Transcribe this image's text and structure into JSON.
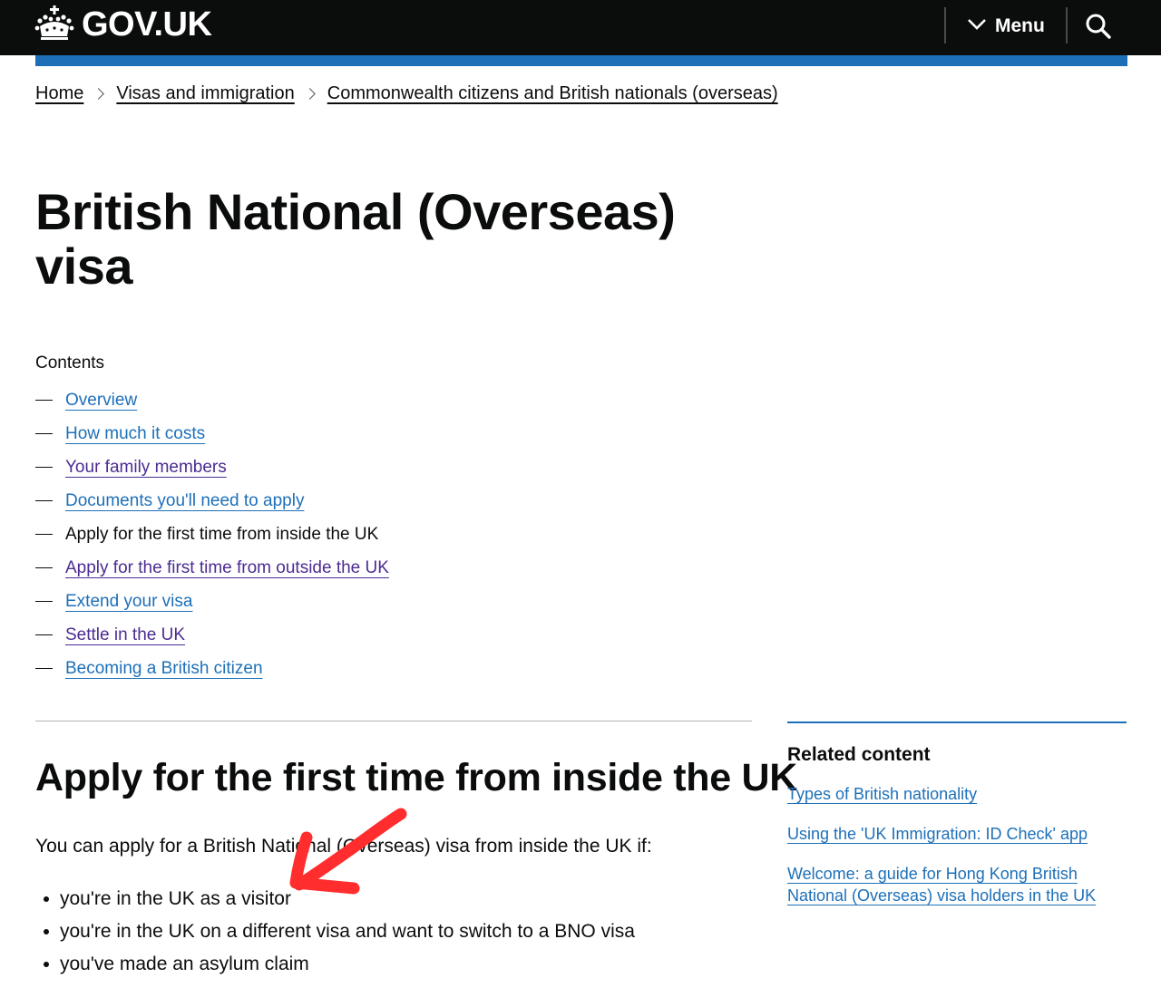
{
  "header": {
    "logo_text": "GOV.UK",
    "logo_icon": "crown-icon",
    "menu_label": "Menu",
    "menu_icon": "chevron-down-icon",
    "search_icon": "search-icon",
    "colors": {
      "header_bg": "#0b0c0c",
      "accent_bar": "#1d70b8",
      "link": "#1d70b8",
      "visited_link": "#4c2c92"
    }
  },
  "breadcrumb": {
    "items": [
      "Home",
      "Visas and immigration",
      "Commonwealth citizens and British nationals (overseas)"
    ]
  },
  "page": {
    "title": "British National (Overseas) visa"
  },
  "contents": {
    "label": "Contents",
    "items": [
      {
        "label": "Overview"
      },
      {
        "label": "How much it costs"
      },
      {
        "label": "Your family members"
      },
      {
        "label": "Documents you'll need to apply"
      },
      {
        "label": "Apply for the first time from inside the UK"
      },
      {
        "label": "Apply for the first time from outside the UK"
      },
      {
        "label": "Extend your visa"
      },
      {
        "label": "Settle in the UK"
      },
      {
        "label": "Becoming a British citizen"
      }
    ]
  },
  "section": {
    "title": "Apply for the first time from inside the UK",
    "intro": "You can apply for a British National (Overseas) visa from inside the UK if:",
    "bullets": [
      "you're in the UK as a visitor",
      "you're in the UK on a different visa and want to switch to a BNO visa",
      "you've made an asylum claim"
    ]
  },
  "related": {
    "title": "Related content",
    "links": [
      "Types of British nationality",
      "Using the 'UK Immigration: ID Check' app",
      "Welcome: a guide for Hong Kong British National (Overseas) visa holders in the UK"
    ]
  },
  "annotation": {
    "icon": "red-arrow-annotation",
    "color": "#ff2d2d"
  }
}
